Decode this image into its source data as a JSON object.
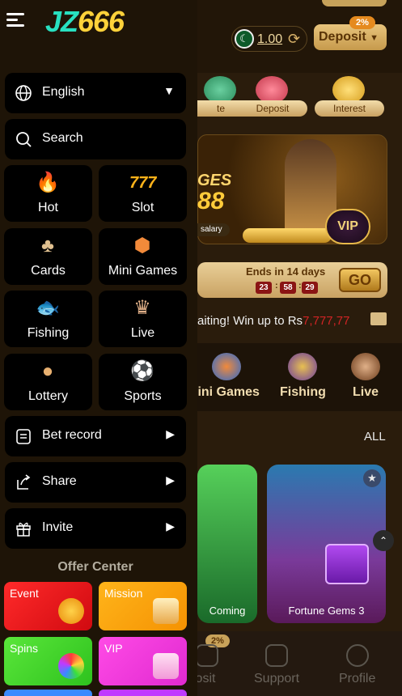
{
  "header": {
    "logo_jz": "JZ",
    "logo_num": "666",
    "balance": "1.00",
    "deposit_label": "Deposit",
    "deposit_badge": "2%"
  },
  "quick_actions": [
    {
      "label": "te"
    },
    {
      "label": "Deposit"
    },
    {
      "label": "Interest"
    }
  ],
  "banner": {
    "line1": "GES",
    "line2": "88",
    "salary": "salary",
    "vip": "VIP"
  },
  "event_timer": {
    "label": "Ends in 14 days",
    "hours": "23",
    "minutes": "58",
    "seconds": "29",
    "go": "GO",
    "sep": ":"
  },
  "marquee": {
    "text": "aiting! Win up to Rs",
    "amount": "7,777,77"
  },
  "categories": [
    {
      "label": "lini Games"
    },
    {
      "label": "Fishing"
    },
    {
      "label": "Live"
    }
  ],
  "games_section": {
    "all_label": "ALL",
    "cards": [
      {
        "name": "Coming"
      },
      {
        "name": "Fortune Gems 3"
      }
    ],
    "scroll_top": "⌃"
  },
  "bottom_nav": {
    "deposit_badge": "2%",
    "items": [
      {
        "label": "osit"
      },
      {
        "label": "Support"
      },
      {
        "label": "Profile"
      }
    ]
  },
  "sidebar": {
    "language": "English",
    "search": "Search",
    "tiles": [
      {
        "label": "Hot",
        "icon": "🔥"
      },
      {
        "label": "Slot",
        "icon": "777"
      },
      {
        "label": "Cards",
        "icon": "♣"
      },
      {
        "label": "Mini Games",
        "icon": "⬢"
      },
      {
        "label": "Fishing",
        "icon": "🐟"
      },
      {
        "label": "Live",
        "icon": "♛"
      },
      {
        "label": "Lottery",
        "icon": "●"
      },
      {
        "label": "Sports",
        "icon": "⚽"
      }
    ],
    "bet_record": "Bet record",
    "share": "Share",
    "invite": "Invite",
    "offer_center": "Offer Center",
    "offers": [
      {
        "label": "Event"
      },
      {
        "label": "Mission"
      },
      {
        "label": "Spins"
      },
      {
        "label": "VIP"
      }
    ]
  },
  "colors": {
    "accent_gold": "#c8a25a",
    "drawer_bg": "#1e1407",
    "event_red": "#e3101a",
    "mission_orange": "#f9a402",
    "spins_green": "#3fd22a",
    "vip_pink": "#f03ad8"
  }
}
